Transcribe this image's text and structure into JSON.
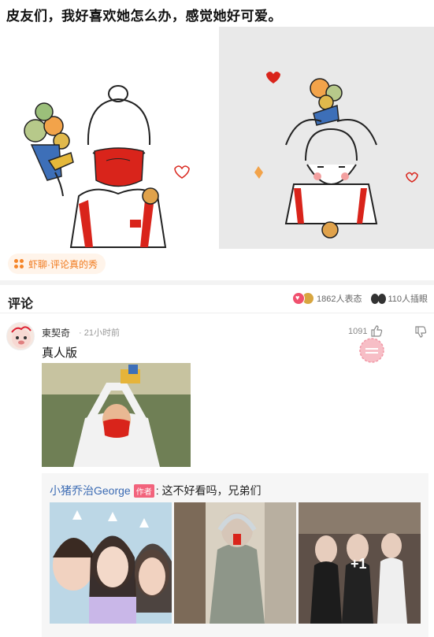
{
  "post": {
    "title": "皮友们，我好喜欢她怎么办，感觉她好可爱。"
  },
  "topic": {
    "label": "虾聊·评论真的秀"
  },
  "comments_section": {
    "title": "评论",
    "reactions_label": "1862人表态",
    "insert_label": "110人插眼"
  },
  "comment": {
    "username": "東契奇",
    "time": "· 21小时前",
    "likes": "1091",
    "text": "真人版"
  },
  "reply": {
    "user": "小猪乔治George",
    "badge": "作者",
    "text": ": 这不好看吗，兄弟们",
    "more_photos": "+1"
  },
  "colors": {
    "accent_orange": "#f07a1e",
    "link_blue": "#3a6ab3",
    "badge_pink": "#f2637c"
  }
}
